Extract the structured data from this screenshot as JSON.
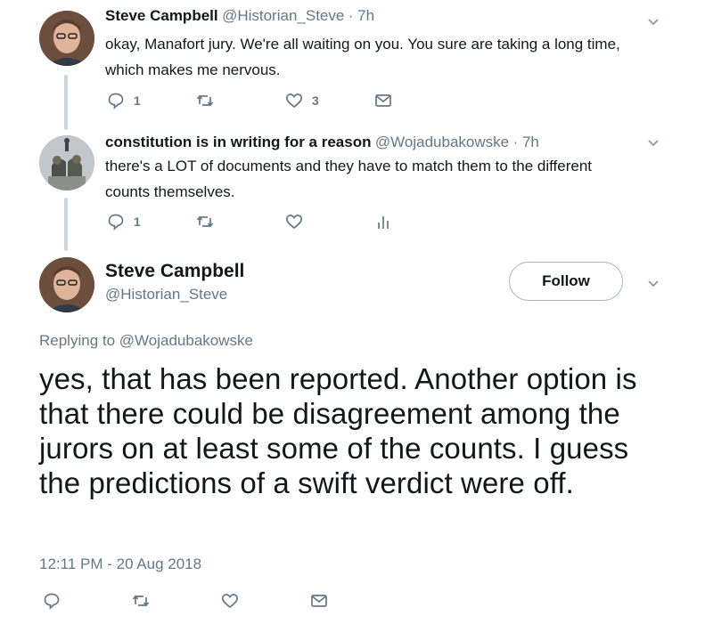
{
  "reply1": {
    "name": "Steve Campbell",
    "handle": "@Historian_Steve",
    "time": "· 7h",
    "text": "okay, Manafort jury. We're all waiting on you. You sure are taking a long time, which makes me nervous.",
    "reply_count": "1",
    "like_count": "3"
  },
  "reply2": {
    "name": "constitution is in writing for a reason",
    "handle": "@Wojadubakowske",
    "time": "· 7h",
    "text": "there's a LOT of documents and they have to match them to the different counts themselves.",
    "reply_count": "1"
  },
  "main_tweet": {
    "name": "Steve Campbell",
    "handle": "@Historian_Steve",
    "follow_label": "Follow",
    "replying_prefix": "Replying to ",
    "replying_to": "@Wojadubakowske",
    "text": "yes, that has been reported. Another option is that there could be disagreement among the jurors on at least some of the counts. I guess the predictions of a swift verdict were off.",
    "timestamp": "12:11 PM - 20 Aug 2018"
  },
  "icons": [
    "reply-icon",
    "retweet-icon",
    "like-icon",
    "dm-icon",
    "analytics-icon",
    "chevron-down-icon"
  ],
  "colors": {
    "secondary_text": "#657786",
    "thread_line": "#ccd6dd",
    "text": "#14171a"
  }
}
